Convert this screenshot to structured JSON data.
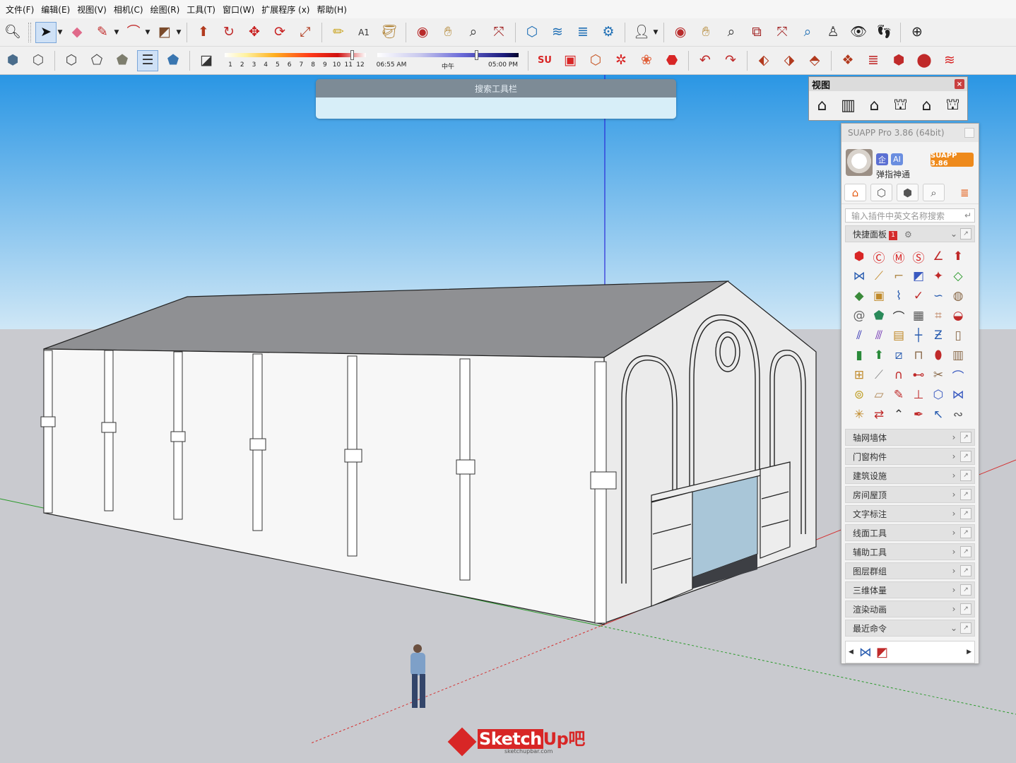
{
  "menu": [
    "文件(F)",
    "编辑(E)",
    "视图(V)",
    "相机(C)",
    "绘图(R)",
    "工具(T)",
    "窗口(W)",
    "扩展程序 (x)",
    "帮助(H)"
  ],
  "shadow": {
    "month_ticks": [
      "1",
      "2",
      "3",
      "4",
      "5",
      "6",
      "7",
      "8",
      "9",
      "10",
      "11",
      "12"
    ],
    "time_start": "06:55 AM",
    "time_mid": "中午",
    "time_end": "05:00 PM",
    "month_value": 0.9,
    "time_value": 0.7
  },
  "search_toolbar": {
    "title": "搜索工具栏"
  },
  "view_palette": {
    "title": "视图",
    "close": "×"
  },
  "suapp": {
    "title": "SUAPP Pro 3.86 (64bit)",
    "badge_enterprise": "企",
    "badge_ai": "AI",
    "user_name": "弹指神通",
    "version_badge": "SUAPP 3.86",
    "search_placeholder": "输入插件中英文名称搜索",
    "quick_panel": {
      "label": "快捷面板",
      "count": "1"
    },
    "categories": [
      "轴网墙体",
      "门窗构件",
      "建筑设施",
      "房间屋顶",
      "文字标注",
      "线面工具",
      "辅助工具",
      "图层群组",
      "三维体量",
      "渲染动画"
    ],
    "recent": "最近命令"
  },
  "watermark": {
    "brand_su": "Sketch",
    "brand_up": "Up吧",
    "url": "sketchupbar.com"
  },
  "colors": {
    "sky_top": "#2a96e4",
    "sky_bottom": "#cfe7f6",
    "ground": "#c9cacf",
    "accent_red": "#d82626",
    "suapp_orange": "#ee8a1c"
  }
}
